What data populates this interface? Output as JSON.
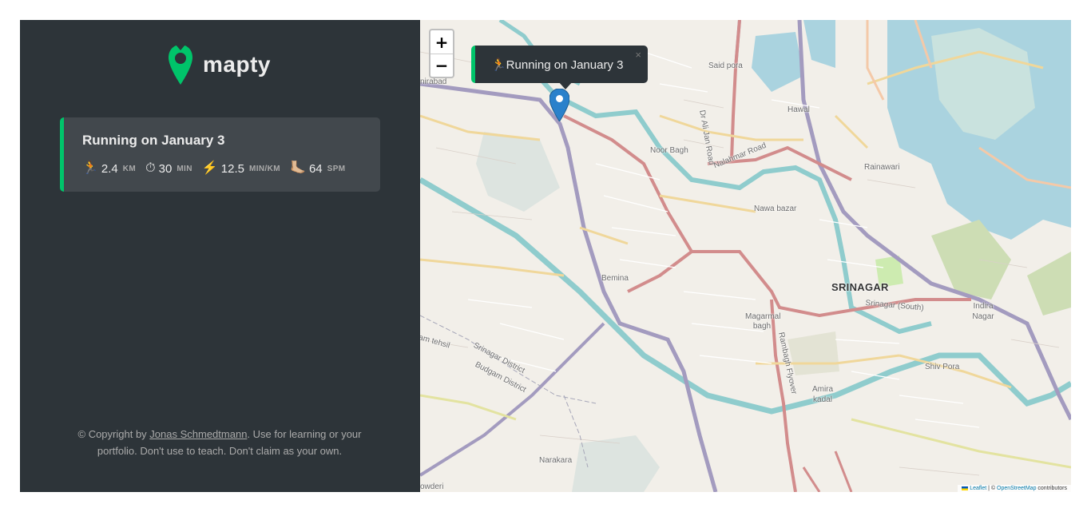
{
  "logo": {
    "text": "mapty"
  },
  "workout": {
    "title": "Running on January 3",
    "details": [
      {
        "icon": "🏃",
        "value": "2.4",
        "unit": "KM"
      },
      {
        "icon": "⏱",
        "value": "30",
        "unit": "MIN"
      },
      {
        "icon": "⚡️",
        "value": "12.5",
        "unit": "MIN/KM"
      },
      {
        "icon": "🦶🏼",
        "value": "64",
        "unit": "SPM"
      }
    ]
  },
  "copyright": {
    "prefix": "© Copyright by",
    "author": "Jonas Schmedtmann",
    "suffix": ". Use for learning or your portfolio. Don't use to teach. Don't claim as your own."
  },
  "map": {
    "zoom_in": "+",
    "zoom_out": "−",
    "popup": {
      "text": "🏃Running on January 3",
      "close": "×"
    },
    "attribution": {
      "leaflet": "Leaflet",
      "sep": " | © ",
      "osm": "OpenStreetMap",
      "suffix": " contributors"
    },
    "places": [
      "Said pora",
      "Hawal",
      "Noor Bagh",
      "Dr Ali Jan Road",
      "Nalahmar Road",
      "Rainawari",
      "Nawa bazar",
      "Bemina",
      "SRINAGAR",
      "Srinagar (South)",
      "Indira Nagar",
      "Magarmal bagh",
      "Rambagh Flyover",
      "Srinagar District",
      "Budgam District",
      "am tehsil",
      "Shiv Pora",
      "Amira kadal",
      "Narakara",
      "nirabad",
      "owderi"
    ]
  },
  "colors": {
    "accent": "#00c46a",
    "sidebar_bg": "#2d3439",
    "card_bg": "#42484d"
  }
}
